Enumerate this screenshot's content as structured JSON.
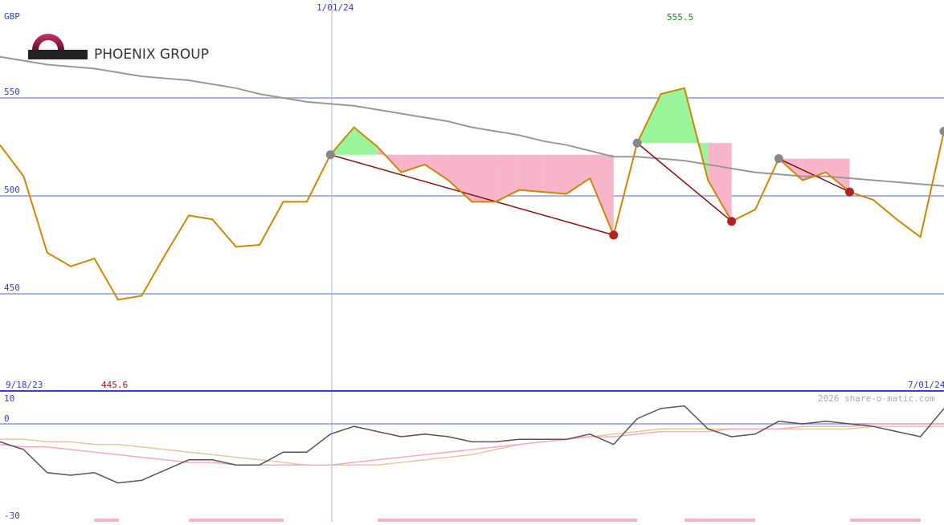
{
  "company": "PHOENIX GROUP",
  "currency": "GBP",
  "watermark": "2026 share-o-matic.com",
  "labels": {
    "start_date": "9/18/23",
    "mid_date": "1/01/24",
    "end_date": "7/01/24",
    "high_value": "555.5",
    "low_value": "445.6"
  },
  "colors": {
    "price": "#cc8800",
    "long_ma": "#999999",
    "gain_fill": "#99f599",
    "loss_fill": "#f8b4c8",
    "trend": "#8b1010",
    "grid": "#8a9ae6",
    "osc": "#555555",
    "osc_pink": "#f4aac4",
    "osc_tan": "#e6c79a"
  },
  "chart_data": [
    {
      "type": "line",
      "name": "price",
      "yticks": [
        450,
        500,
        550
      ],
      "ylim": [
        400,
        600
      ],
      "x": [
        "2023-09-18",
        "2023-09-25",
        "2023-10-02",
        "2023-10-09",
        "2023-10-16",
        "2023-10-23",
        "2023-10-30",
        "2023-11-06",
        "2023-11-13",
        "2023-11-20",
        "2023-11-27",
        "2023-12-04",
        "2023-12-11",
        "2023-12-18",
        "2023-12-25",
        "2024-01-01",
        "2024-01-08",
        "2024-01-15",
        "2024-01-22",
        "2024-01-29",
        "2024-02-05",
        "2024-02-12",
        "2024-02-19",
        "2024-02-26",
        "2024-03-04",
        "2024-03-11",
        "2024-03-18",
        "2024-03-25",
        "2024-04-01",
        "2024-04-08",
        "2024-04-15",
        "2024-04-22",
        "2024-04-29",
        "2024-05-06",
        "2024-05-13",
        "2024-05-20",
        "2024-05-27",
        "2024-06-03",
        "2024-06-10",
        "2024-06-17",
        "2024-06-24",
        "2024-07-01"
      ],
      "series": [
        {
          "values": [
            526,
            510,
            471,
            464,
            468,
            447,
            449,
            470,
            490,
            488,
            474,
            475,
            497,
            497,
            521,
            535,
            525,
            512,
            516,
            508,
            497,
            497,
            503,
            502,
            501,
            509,
            480,
            527,
            552,
            555,
            508,
            487,
            493,
            519,
            508,
            512,
            502,
            498,
            488,
            479,
            533
          ]
        },
        {
          "values": [
            571,
            569,
            567,
            566,
            565,
            563,
            561,
            560,
            559,
            557,
            555,
            552,
            550,
            548,
            547,
            546,
            544,
            542,
            540,
            538,
            535,
            533,
            531,
            528,
            526,
            523,
            520,
            520,
            519,
            518,
            516,
            514,
            512,
            511,
            510,
            510,
            509,
            508,
            507,
            506,
            505
          ]
        }
      ],
      "annotations": [
        "555.5",
        "445.6"
      ]
    },
    {
      "type": "line",
      "name": "oscillator",
      "yticks": [
        10,
        0,
        -30
      ],
      "ylim": [
        -30,
        10
      ],
      "series": [
        {
          "values": [
            -7,
            -10,
            -19,
            -20,
            -19,
            -23,
            -22,
            -18,
            -14,
            -14,
            -16,
            -16,
            -11,
            -11,
            -4,
            -1,
            -3,
            -5,
            -4,
            -5,
            -7,
            -7,
            -6,
            -6,
            -6,
            -4,
            -8,
            2,
            6,
            7,
            -2,
            -5,
            -4,
            1,
            0,
            1,
            0,
            -1,
            -3,
            -5,
            6
          ]
        },
        {
          "values": [
            -8,
            -9,
            -9,
            -10,
            -11,
            -12,
            -13,
            -14,
            -15,
            -15,
            -16,
            -16,
            -16,
            -16,
            -16,
            -15,
            -14,
            -13,
            -12,
            -11,
            -10,
            -9,
            -8,
            -7,
            -6,
            -5,
            -5,
            -4,
            -3,
            -3,
            -3,
            -2,
            -2,
            -2,
            -1,
            -1,
            -1,
            0,
            0,
            0,
            0
          ]
        },
        {
          "values": [
            -6,
            -6,
            -7,
            -7,
            -8,
            -8,
            -9,
            -10,
            -11,
            -12,
            -13,
            -14,
            -15,
            -16,
            -16,
            -16,
            -16,
            -15,
            -14,
            -13,
            -12,
            -10,
            -8,
            -7,
            -6,
            -5,
            -4,
            -3,
            -2,
            -2,
            -2,
            -2,
            -2,
            -2,
            -2,
            -2,
            -2,
            -1,
            -1,
            -1,
            -1
          ]
        }
      ]
    }
  ]
}
